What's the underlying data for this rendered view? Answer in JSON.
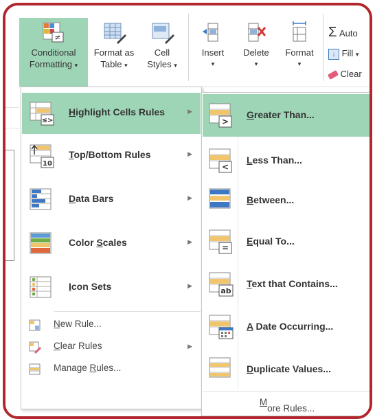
{
  "ribbon": {
    "conditional_formatting": {
      "line1": "Conditional",
      "line2": "Formatting",
      "caret": "▾"
    },
    "format_as_table": {
      "line1": "Format as",
      "line2": "Table",
      "caret": "▾"
    },
    "cell_styles": {
      "line1": "Cell",
      "line2": "Styles",
      "caret": "▾"
    },
    "insert": {
      "label": "Insert",
      "caret": "▾"
    },
    "delete": {
      "label": "Delete",
      "caret": "▾"
    },
    "format": {
      "label": "Format",
      "caret": "▾"
    },
    "autosum": {
      "label": "Auto"
    },
    "fill": {
      "label": "Fill",
      "caret": "▾"
    },
    "clear": {
      "label": "Clear"
    }
  },
  "menu": {
    "items": [
      {
        "pre": "",
        "key": "H",
        "post": "ighlight Cells Rules",
        "icon": "highlight-cells-icon",
        "arrow": "▶"
      },
      {
        "pre": "",
        "key": "T",
        "post": "op/Bottom Rules",
        "icon": "top-bottom-icon",
        "arrow": "▶"
      },
      {
        "pre": "",
        "key": "D",
        "post": "ata Bars",
        "icon": "data-bars-icon",
        "arrow": "▶"
      },
      {
        "pre": "Color ",
        "key": "S",
        "post": "cales",
        "icon": "color-scales-icon",
        "arrow": "▶"
      },
      {
        "pre": "",
        "key": "I",
        "post": "con Sets",
        "icon": "icon-sets-icon",
        "arrow": "▶"
      }
    ],
    "small": [
      {
        "pre": "",
        "key": "N",
        "post": "ew Rule...",
        "icon": "new-rule-icon"
      },
      {
        "pre": "",
        "key": "C",
        "post": "lear Rules",
        "icon": "clear-rules-icon",
        "arrow": "▶"
      },
      {
        "pre": "Manage ",
        "key": "R",
        "post": "ules...",
        "icon": "manage-rules-icon"
      }
    ]
  },
  "submenu": {
    "items": [
      {
        "pre": "",
        "key": "G",
        "post": "reater Than...",
        "icon": "greater-than-icon"
      },
      {
        "pre": "",
        "key": "L",
        "post": "ess Than...",
        "icon": "less-than-icon"
      },
      {
        "pre": "",
        "key": "B",
        "post": "etween...",
        "icon": "between-icon"
      },
      {
        "pre": "",
        "key": "E",
        "post": "qual To...",
        "icon": "equal-to-icon"
      },
      {
        "pre": "",
        "key": "T",
        "post": "ext that Contains...",
        "icon": "text-contains-icon"
      },
      {
        "pre": "",
        "key": "A",
        "post": " Date Occurring...",
        "icon": "date-occurring-icon"
      },
      {
        "pre": "",
        "key": "D",
        "post": "uplicate Values...",
        "icon": "duplicate-values-icon"
      }
    ],
    "more": {
      "pre": "",
      "key": "M",
      "post": "ore Rules..."
    }
  },
  "colors": {
    "highlight": "#9fd5b7",
    "frame": "#b0272d"
  }
}
